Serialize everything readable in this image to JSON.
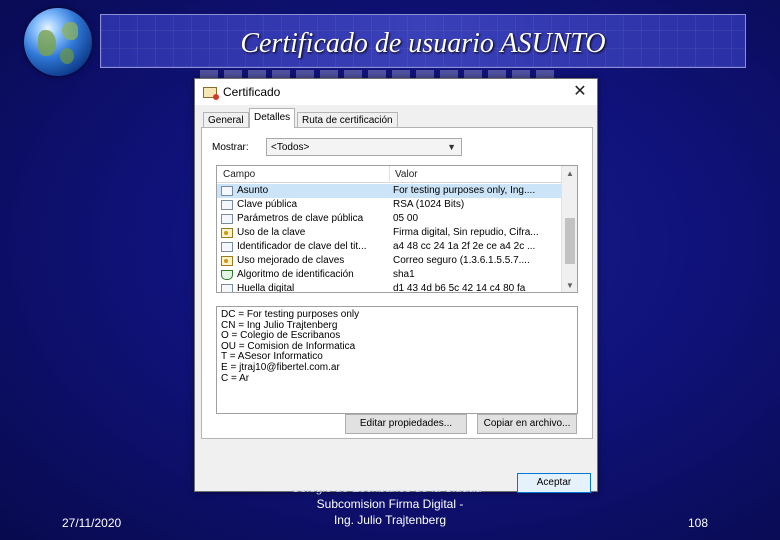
{
  "slide": {
    "title": "Certificado de usuario ASUNTO",
    "footer_date": "27/11/2020",
    "footer_line1": "Colegio de Escribanos de la Ciudad -",
    "footer_line2": "Subcomision Firma Digital -",
    "footer_line3": "Ing. Julio Trajtenberg",
    "page_number": "108"
  },
  "dialog": {
    "title": "Certificado",
    "close_glyph": "✕",
    "tabs": [
      {
        "label": "General"
      },
      {
        "label": "Detalles"
      },
      {
        "label": "Ruta de certificación"
      }
    ],
    "active_tab": "Detalles",
    "show_label": "Mostrar:",
    "show_value": "<Todos>",
    "columns": {
      "field": "Campo",
      "value": "Valor"
    },
    "rows": [
      {
        "field": "Asunto",
        "value": "For testing purposes only, Ing....",
        "icon": "cert-icon",
        "selected": true
      },
      {
        "field": "Clave pública",
        "value": "RSA (1024 Bits)",
        "icon": "cert-icon"
      },
      {
        "field": "Parámetros de clave pública",
        "value": "05 00",
        "icon": "cert-icon"
      },
      {
        "field": "Uso de la clave",
        "value": "Firma digital, Sin repudio, Cifra...",
        "icon": "key-icon"
      },
      {
        "field": "Identificador de clave del tit...",
        "value": "a4 48 cc 24 1a 2f 2e ce a4 2c ...",
        "icon": "cert-icon"
      },
      {
        "field": "Uso mejorado de claves",
        "value": "Correo seguro (1.3.6.1.5.5.7....",
        "icon": "key-icon"
      },
      {
        "field": "Algoritmo de identificación",
        "value": "sha1",
        "icon": "shield-icon"
      },
      {
        "field": "Huella digital",
        "value": "d1 43 4d b6 5c 42 14 c4 80 fa",
        "icon": "cert-icon"
      }
    ],
    "detail_lines": [
      "DC = For testing purposes only",
      "CN = Ing Julio Trajtenberg",
      "O = Colegio de Escribanos",
      "OU = Comision de Informatica",
      "T = ASesor Informatico",
      "E = jtraj10@fibertel.com.ar",
      "C = Ar"
    ],
    "edit_button": "Editar propiedades...",
    "copy_button": "Copiar en archivo...",
    "accept_button": "Aceptar"
  }
}
